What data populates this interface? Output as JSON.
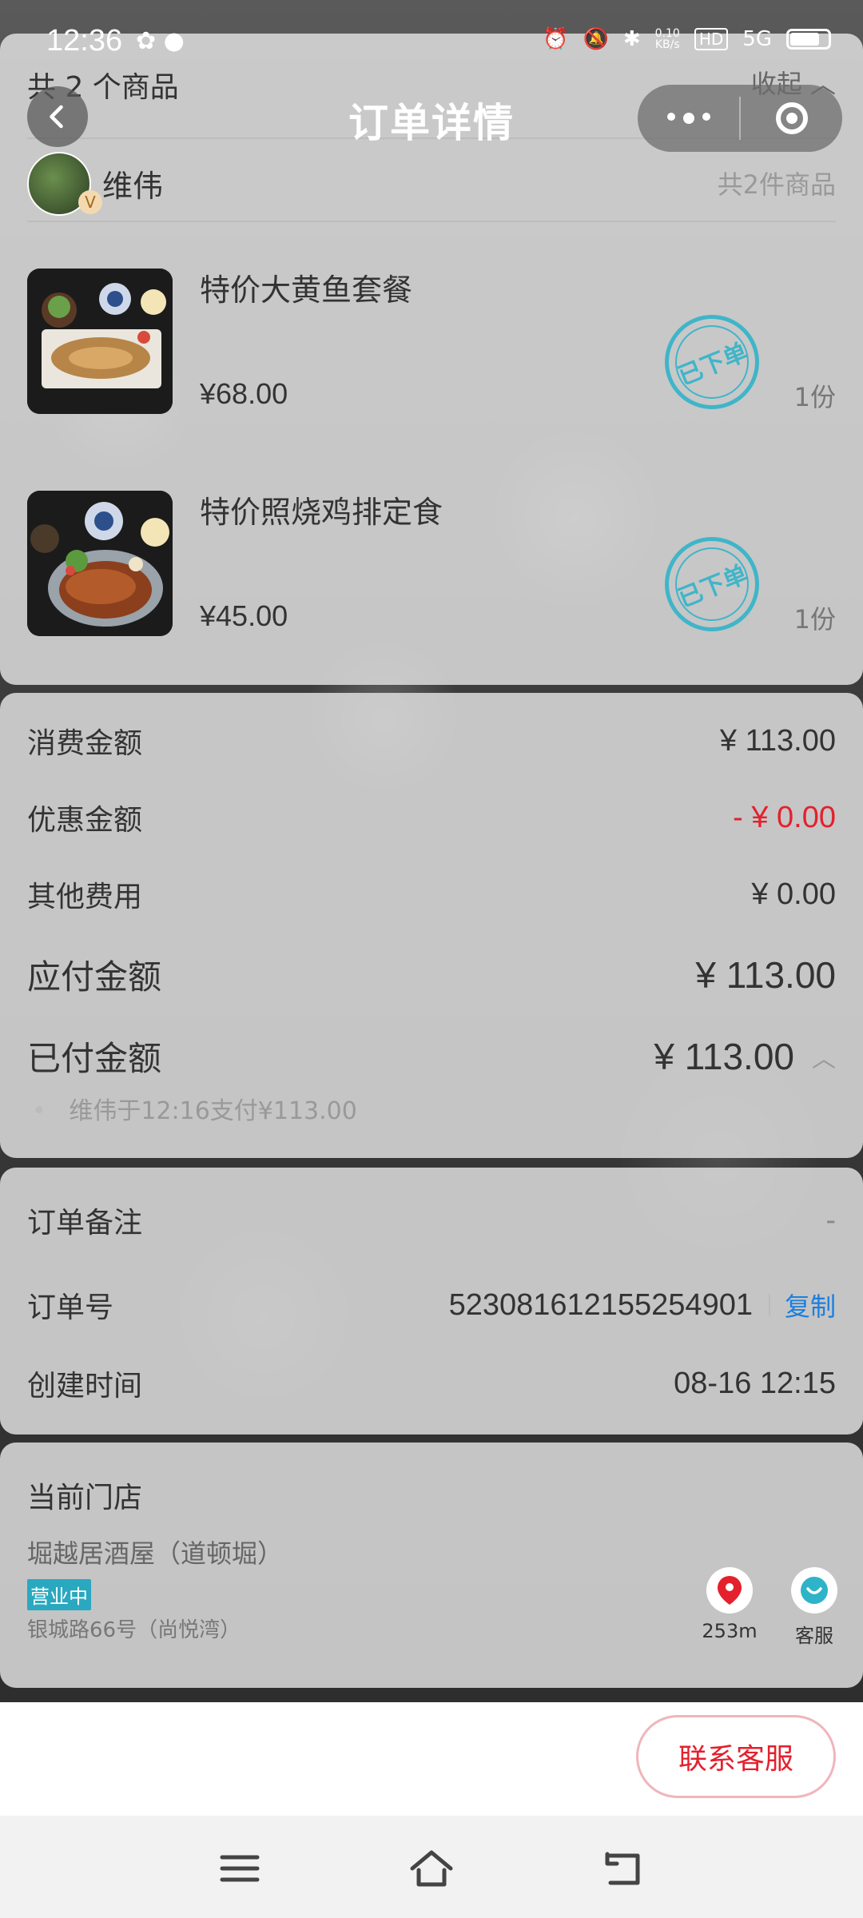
{
  "status_bar": {
    "time": "12:36",
    "speed_top": "0.10",
    "speed_bottom": "KB/s",
    "hd": "HD",
    "net": "5G"
  },
  "nav": {
    "title": "订单详情"
  },
  "items_header": {
    "count_text": "共 2 个商品",
    "collapse": "收起",
    "user_name": "维伟",
    "vip_badge": "V",
    "total_items": "共2件商品"
  },
  "products": [
    {
      "name": "特价大黄鱼套餐",
      "price": "¥68.00",
      "stamp": "已下单",
      "qty": "1份"
    },
    {
      "name": "特价照烧鸡排定食",
      "price": "¥45.00",
      "stamp": "已下单",
      "qty": "1份"
    }
  ],
  "amounts": {
    "consume_label": "消费金额",
    "consume_value": "¥ 113.00",
    "discount_label": "优惠金额",
    "discount_value": "- ¥ 0.00",
    "other_label": "其他费用",
    "other_value": "¥ 0.00",
    "payable_label": "应付金额",
    "payable_value": "¥ 113.00",
    "paid_label": "已付金额",
    "paid_value": "¥ 113.00",
    "paid_detail": "维伟于12:16支付¥113.00"
  },
  "order_info": {
    "remark_label": "订单备注",
    "remark_value": "-",
    "order_no_label": "订单号",
    "order_no_value": "523081612155254901",
    "copy": "复制",
    "created_label": "创建时间",
    "created_value": "08-16 12:15"
  },
  "store": {
    "title": "当前门店",
    "name": "堀越居酒屋（道顿堀）",
    "status": "营业中",
    "address": "银城路66号（尚悦湾）",
    "distance": "253m",
    "service": "客服"
  },
  "bottom": {
    "contact": "联系客服"
  },
  "colors": {
    "accent_red": "#e4202d",
    "stamp_teal": "#3fb5c9",
    "link_blue": "#1a7fe0"
  }
}
